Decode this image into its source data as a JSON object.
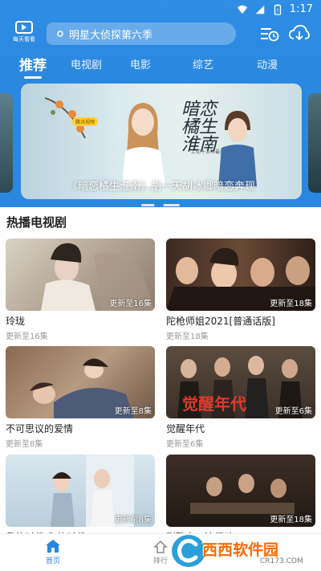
{
  "status": {
    "time": "1:17"
  },
  "app": {
    "logo_text": "每天看看"
  },
  "search": {
    "placeholder": "明星大侦探第六季"
  },
  "tabs": [
    {
      "label": "推荐",
      "active": true
    },
    {
      "label": "电视剧",
      "active": false
    },
    {
      "label": "电影",
      "active": false
    },
    {
      "label": "综艺",
      "active": false
    },
    {
      "label": "动漫",
      "active": false
    }
  ],
  "banner": {
    "caption": "《暗恋橘生淮南》胡一天胡冰卿暗恋奔现",
    "calligraphy": "暗恋橘生淮南",
    "tag": "腾讯视频",
    "subtitle": "上旬十五年最美暗恋"
  },
  "section": {
    "title": "热播电视剧"
  },
  "cards": [
    {
      "title": "玲珑",
      "badge": "更新至16集",
      "sub": "更新至16集"
    },
    {
      "title": "陀枪师姐2021[普通话版]",
      "badge": "更新至18集",
      "sub": "更新至18集"
    },
    {
      "title": "不可思议的爱情",
      "badge": "更新至8集",
      "sub": "更新至8集"
    },
    {
      "title": "觉醒年代",
      "badge": "更新至6集",
      "sub": "更新至6集",
      "poster_text": "觉醒年代"
    },
    {
      "title": "我的时代 你的时代",
      "badge": "更新至8集",
      "sub": ""
    },
    {
      "title": "刑警之一流行动",
      "badge": "更新至18集",
      "sub": ""
    }
  ],
  "bottom_nav": [
    {
      "label": "首页",
      "active": true
    },
    {
      "label": "排行",
      "active": false
    }
  ],
  "watermark": {
    "text": "西西软件园",
    "url": "CR173.COM"
  },
  "colors": {
    "brand_blue": "#2a87df",
    "watermark_orange": "#ff6a00"
  }
}
